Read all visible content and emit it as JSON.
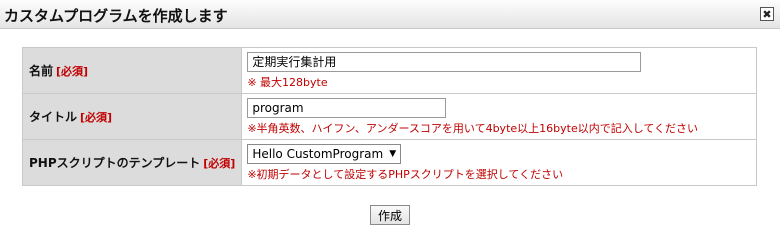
{
  "window": {
    "title": "カスタムプログラムを作成します",
    "close_icon": "close-icon",
    "close_glyph": "✖"
  },
  "form": {
    "fields": {
      "name": {
        "label": "名前",
        "required": "[必須]",
        "value": "定期実行集計用",
        "note": "※ 最大128byte"
      },
      "title": {
        "label": "タイトル",
        "required": "[必須]",
        "value": "program",
        "note": "※半角英数、ハイフン、アンダースコアを用いて4byte以上16byte以内で記入してください"
      },
      "template": {
        "label": "PHPスクリプトのテンプレート",
        "required": "[必須]",
        "selected": "Hello CustomProgram",
        "note": "※初期データとして設定するPHPスクリプトを選択してください"
      }
    },
    "submit_label": "作成"
  },
  "colors": {
    "required_red": "#c00000",
    "label_bg": "#dcdcdc",
    "border": "#c9c9c9"
  }
}
